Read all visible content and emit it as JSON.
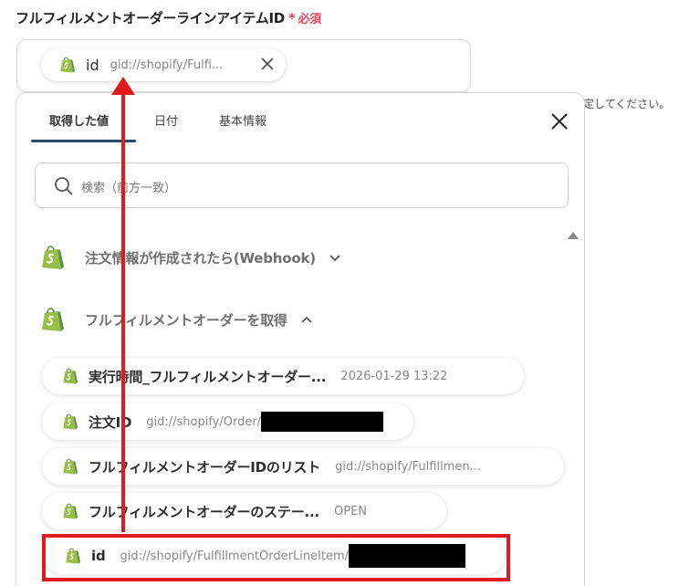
{
  "field": {
    "label": "フルフィルメントオーダーラインアイテムID",
    "required_star": "*",
    "required_text": "必須"
  },
  "chip": {
    "key": "id",
    "value": "gid://shopify/Fulfi..."
  },
  "hint_text": "定してください。",
  "tabs": [
    {
      "label": "取得した値",
      "active": true
    },
    {
      "label": "日付",
      "active": false
    },
    {
      "label": "基本情報",
      "active": false
    }
  ],
  "search": {
    "placeholder": "検索（前方一致）"
  },
  "sections": [
    {
      "label": "注文情報が作成されたら(Webhook)",
      "expanded": false
    },
    {
      "label": "フルフィルメントオーダーを取得",
      "expanded": true
    }
  ],
  "items": [
    {
      "key": "実行時間_フルフィルメントオーダー...",
      "value": "2026-01-29 13:22"
    },
    {
      "key": "注文ID",
      "value": "gid://shopify/Order/"
    },
    {
      "key": "フルフィルメントオーダーIDのリスト",
      "value": "gid://shopify/Fulfillmen..."
    },
    {
      "key": "フルフィルメントオーダーのステー...",
      "value": "OPEN"
    },
    {
      "key": "id",
      "value": "gid://shopify/FulfillmentOrderLineItem/"
    }
  ],
  "colors": {
    "required": "#e0475b",
    "shopify_green": "#95bf47",
    "shopify_dark": "#5e8e3e",
    "tab_underline": "#2b4a70",
    "annotation_red": "#e01b1b"
  },
  "icons": [
    "shopify-bag-icon",
    "close-icon",
    "search-icon",
    "chevron-down-icon",
    "chevron-up-icon",
    "scroll-up-icon"
  ]
}
